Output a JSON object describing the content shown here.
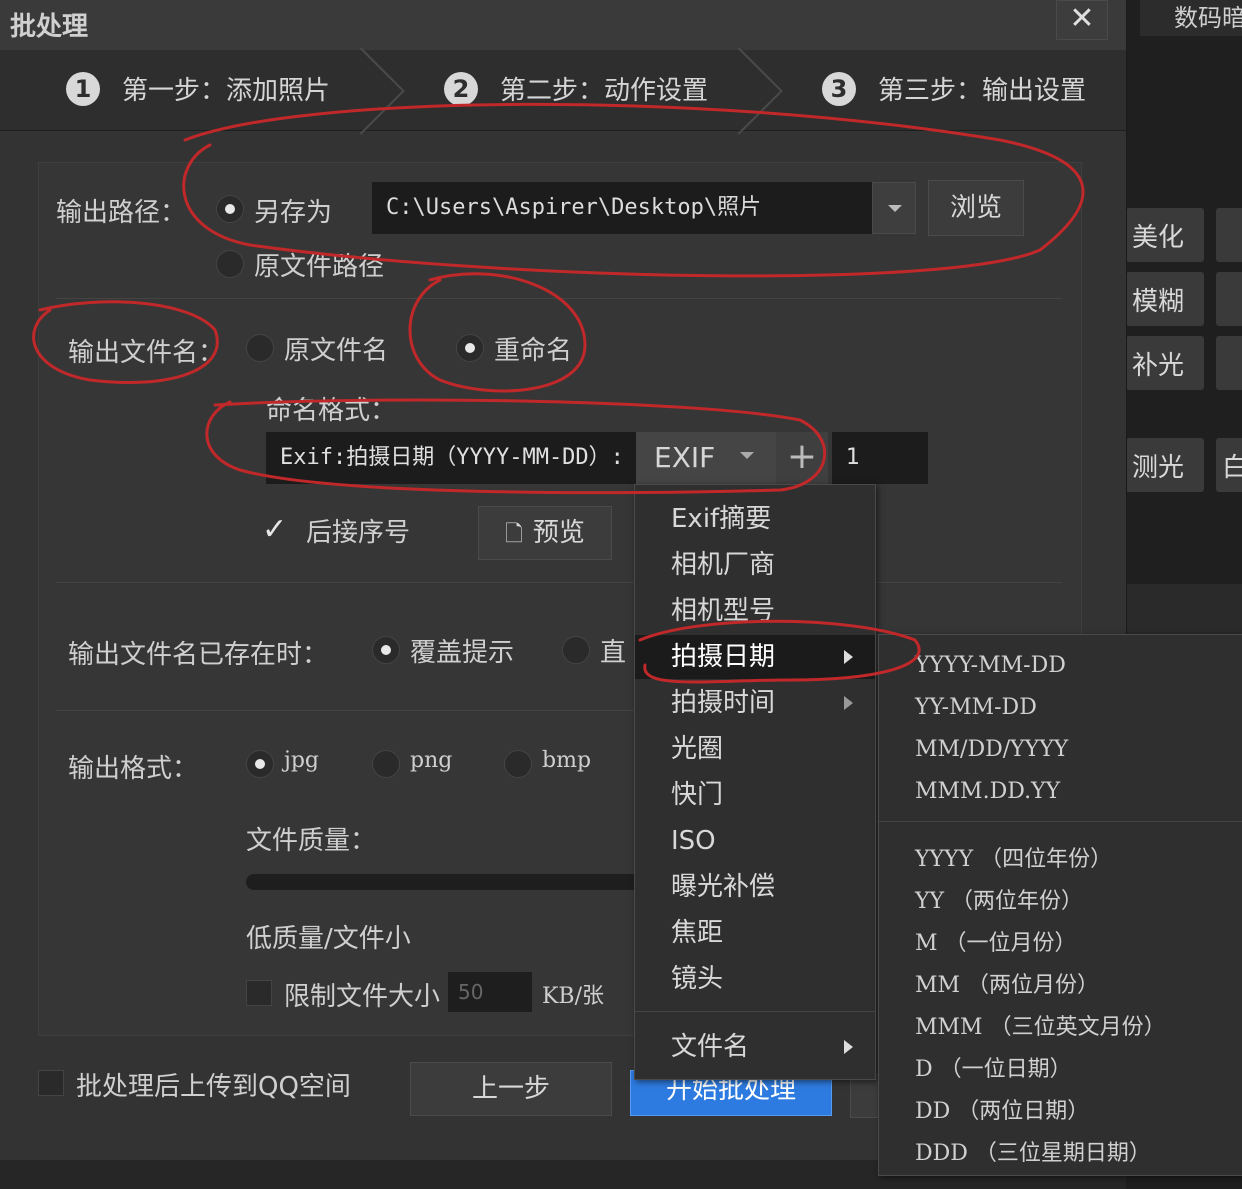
{
  "window": {
    "title": "批处理",
    "close_label": "✕"
  },
  "background_app": {
    "top_label": "数码暗",
    "side_mark": "",
    "tiles": [
      "美化",
      "模糊",
      "补光",
      "测光",
      "白"
    ]
  },
  "steps": [
    {
      "num": "1",
      "label": "第一步：添加照片"
    },
    {
      "num": "2",
      "label": "第二步：动作设置"
    },
    {
      "num": "3",
      "label": "第三步：输出设置"
    }
  ],
  "output_path": {
    "label": "输出路径：",
    "option_save_as": "另存为",
    "option_original": "原文件路径",
    "path_value": "C:\\Users\\Aspirer\\Desktop\\照片",
    "browse_label": "浏览"
  },
  "output_filename": {
    "label": "输出文件名：",
    "option_original": "原文件名",
    "option_rename": "重命名",
    "format_label": "命名格式：",
    "format_value": "Exif:拍摄日期（YYYY-MM-DD）:",
    "exif_label": "EXIF",
    "plus_label": "+",
    "start_number": "1",
    "suffix_seq_label": "后接序号",
    "preview_label": "预览"
  },
  "exists": {
    "label": "输出文件名已存在时：",
    "option_overwrite": "覆盖提示",
    "option_direct": "直"
  },
  "format": {
    "label": "输出格式：",
    "options": [
      "jpg",
      "png",
      "bmp"
    ],
    "quality_label": "文件质量：",
    "low_quality_label": "低质量/文件小",
    "limit_size_label": "限制文件大小",
    "limit_size_value": "50",
    "limit_size_unit": "KB/张"
  },
  "footer": {
    "upload_label": "批处理后上传到QQ空间",
    "prev_label": "上一步",
    "start_label": "开始批处理"
  },
  "menu": {
    "items": [
      "Exif摘要",
      "相机厂商",
      "相机型号",
      "拍摄日期",
      "拍摄时间",
      "光圈",
      "快门",
      "ISO",
      "曝光补偿",
      "焦距",
      "镜头",
      "文件名"
    ],
    "highlighted": "拍摄日期"
  },
  "submenu": {
    "items": [
      "YYYY-MM-DD",
      "YY-MM-DD",
      "MM/DD/YYYY",
      "MMM.DD.YY",
      "YYYY （四位年份）",
      "YY （两位年份）",
      "M （一位月份）",
      "MM （两位月份）",
      "MMM （三位英文月份）",
      "D （一位日期）",
      "DD （两位日期）",
      "DDD （三位星期日期）"
    ]
  },
  "colors": {
    "annotation": "#c0282a",
    "accent_button": "#2d7be0"
  }
}
